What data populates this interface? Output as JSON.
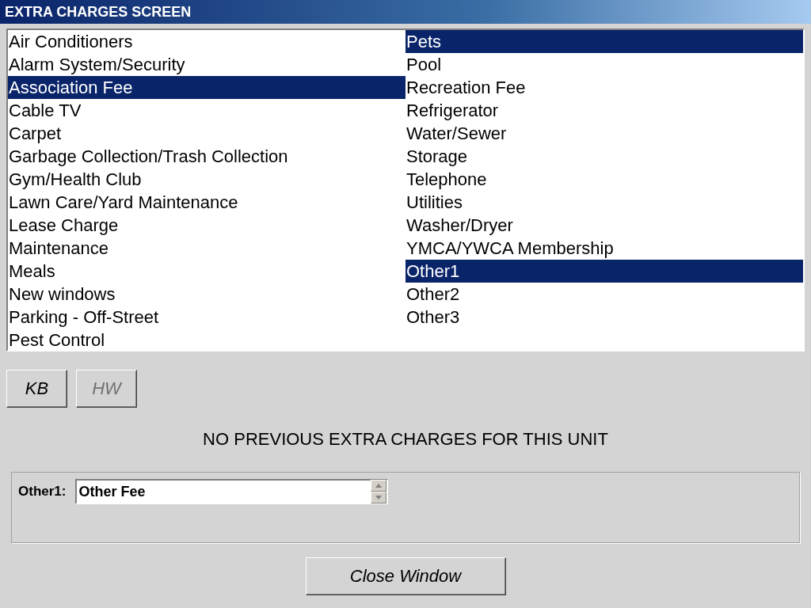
{
  "window": {
    "title": "EXTRA CHARGES SCREEN"
  },
  "charges": [
    {
      "label": "Air Conditioners",
      "selected": false
    },
    {
      "label": "Alarm System/Security",
      "selected": false
    },
    {
      "label": "Association Fee",
      "selected": true
    },
    {
      "label": "Cable TV",
      "selected": false
    },
    {
      "label": "Carpet",
      "selected": false
    },
    {
      "label": "Garbage Collection/Trash Collection",
      "selected": false
    },
    {
      "label": "Gym/Health Club",
      "selected": false
    },
    {
      "label": "Lawn Care/Yard Maintenance",
      "selected": false
    },
    {
      "label": "Lease Charge",
      "selected": false
    },
    {
      "label": "Maintenance",
      "selected": false
    },
    {
      "label": "Meals",
      "selected": false
    },
    {
      "label": "New windows",
      "selected": false
    },
    {
      "label": "Parking - Off-Street",
      "selected": false
    },
    {
      "label": "Pest Control",
      "selected": false
    },
    {
      "label": "Pets",
      "selected": true
    },
    {
      "label": "Pool",
      "selected": false
    },
    {
      "label": "Recreation Fee",
      "selected": false
    },
    {
      "label": "Refrigerator",
      "selected": false
    },
    {
      "label": "Water/Sewer",
      "selected": false
    },
    {
      "label": "Storage",
      "selected": false
    },
    {
      "label": "Telephone",
      "selected": false
    },
    {
      "label": "Utilities",
      "selected": false
    },
    {
      "label": "Washer/Dryer",
      "selected": false
    },
    {
      "label": "YMCA/YWCA Membership",
      "selected": false
    },
    {
      "label": "Other1",
      "selected": true
    },
    {
      "label": "Other2",
      "selected": false
    },
    {
      "label": "Other3",
      "selected": false
    }
  ],
  "mode_buttons": [
    {
      "label": "KB",
      "disabled": false
    },
    {
      "label": "HW",
      "disabled": true
    }
  ],
  "message": "NO PREVIOUS EXTRA CHARGES FOR THIS UNIT",
  "fields": [
    {
      "label": "Other1:",
      "value": "Other Fee"
    }
  ],
  "close_button": "Close Window"
}
